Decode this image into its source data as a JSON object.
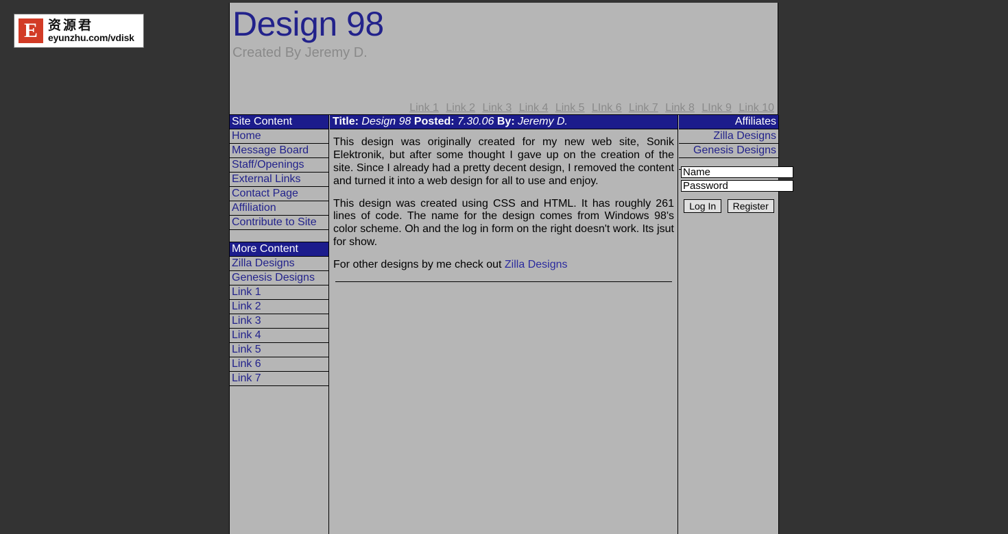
{
  "watermark": {
    "badge_letter": "E",
    "chinese_text": "资源君",
    "url_text": "eyunzhu.com/vdisk"
  },
  "banner": {
    "title": "Design 98",
    "subtitle": "Created By Jeremy D."
  },
  "topnav": {
    "links": [
      {
        "label": "Link 1"
      },
      {
        "label": "Link 2"
      },
      {
        "label": "Link 3"
      },
      {
        "label": "Link 4"
      },
      {
        "label": "Link 5"
      },
      {
        "label": "LInk 6"
      },
      {
        "label": "Link 7"
      },
      {
        "label": "Link 8"
      },
      {
        "label": "LInk 9"
      },
      {
        "label": "Link 10"
      }
    ]
  },
  "sidebar": {
    "heading": "Site Content",
    "items": [
      {
        "label": "Home"
      },
      {
        "label": "Message Board"
      },
      {
        "label": "Staff/Openings"
      },
      {
        "label": "External Links"
      },
      {
        "label": "Contact Page"
      },
      {
        "label": "Affiliation"
      },
      {
        "label": "Contribute to Site"
      }
    ],
    "heading2": "More Content",
    "items2": [
      {
        "label": "Zilla Designs"
      },
      {
        "label": "Genesis Designs"
      },
      {
        "label": "Link 1"
      },
      {
        "label": "Link 2"
      },
      {
        "label": "Link 3"
      },
      {
        "label": "Link 4"
      },
      {
        "label": "Link 5"
      },
      {
        "label": "Link 6"
      },
      {
        "label": "Link 7"
      }
    ]
  },
  "article": {
    "title_label": "Title:",
    "title_value": "Design 98",
    "posted_label": "Posted:",
    "posted_value": "7.30.06",
    "by_label": "By:",
    "by_value": "Jeremy D.",
    "paragraph1": "This design was originally created for my new web site, Sonik Elektronik, but after some thought I gave up on the creation of the site. Since I already had a pretty decent design, I removed the content and turned it into a web design for all to use and enjoy.",
    "paragraph2": "This design was created using CSS and HTML. It has roughly 261 lines of code. The name for the design comes from Windows 98's color scheme. Oh and the log in form on the right doesn't work. Its jsut for show.",
    "paragraph3_prefix": "For other designs by me check out ",
    "paragraph3_link": "Zilla Designs"
  },
  "affiliates": {
    "heading": "Affiliates",
    "items": [
      {
        "label": "Zilla Designs"
      },
      {
        "label": "Genesis Designs"
      }
    ]
  },
  "login": {
    "name_value": "Name",
    "password_value": "Password",
    "login_button": "Log In",
    "register_button": "Register"
  },
  "colors": {
    "page_background": "#333333",
    "panel_background": "#b6b6b6",
    "header_navy": "#1c1c8c",
    "link_navy": "#22228b",
    "muted_gray": "#8a8a8a",
    "logo_red": "#d23b26"
  }
}
